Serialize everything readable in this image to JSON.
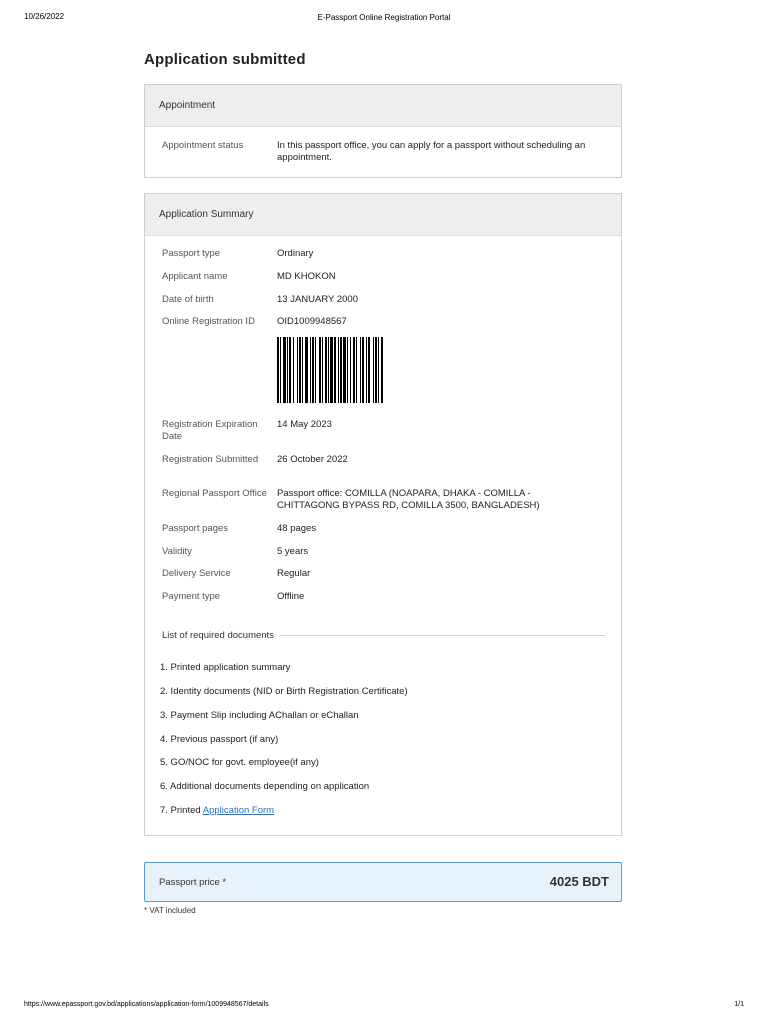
{
  "print_header": {
    "date": "10/26/2022",
    "title": "E-Passport Online Registration Portal"
  },
  "print_footer": {
    "url": "https://www.epassport.gov.bd/applications/application-form/1009948567/details",
    "page": "1/1"
  },
  "page_title": "Application submitted",
  "appointment": {
    "header": "Appointment",
    "status_label": "Appointment status",
    "status_value": "In this passport office, you can apply for a passport without scheduling an appointment."
  },
  "summary": {
    "header": "Application Summary",
    "rows": [
      {
        "label": "Passport type",
        "value": "Ordinary"
      },
      {
        "label": "Applicant name",
        "value": "MD KHOKON"
      },
      {
        "label": "Date of birth",
        "value": "13 JANUARY 2000"
      },
      {
        "label": "Online Registration ID",
        "value": "OID1009948567"
      },
      {
        "label": "Registration Expiration Date",
        "value": "14 May 2023"
      },
      {
        "label": "Registration Submitted",
        "value": "26 October 2022"
      },
      {
        "label": "Regional Passport Office",
        "value": "Passport office: COMILLA (NOAPARA, DHAKA - COMILLA - CHITTAGONG BYPASS RD, COMILLA 3500, BANGLADESH)"
      },
      {
        "label": "Passport pages",
        "value": "48 pages"
      },
      {
        "label": "Validity",
        "value": "5 years"
      },
      {
        "label": "Delivery Service",
        "value": "Regular"
      },
      {
        "label": "Payment type",
        "value": "Offline"
      }
    ],
    "docs_header": "List of required documents",
    "docs": [
      "1. Printed application summary",
      "2. Identity documents (NID or Birth Registration Certificate)",
      "3. Payment Slip including AChallan or eChallan",
      "4. Previous passport (if any)",
      "5. GO/NOC for govt. employee(if any)",
      "6. Additional documents depending on application"
    ],
    "doc7_prefix": "7. Printed ",
    "doc7_link": "Application Form"
  },
  "price": {
    "label": "Passport price *",
    "value": "4025 BDT",
    "note": "* VAT included"
  },
  "colors": {
    "link": "#2a6ebd",
    "price_border": "#5b9ad1",
    "price_bg": "#e8f2fb",
    "card_header_bg": "#eeeeee"
  },
  "icons": {
    "barcode": "barcode-icon"
  }
}
